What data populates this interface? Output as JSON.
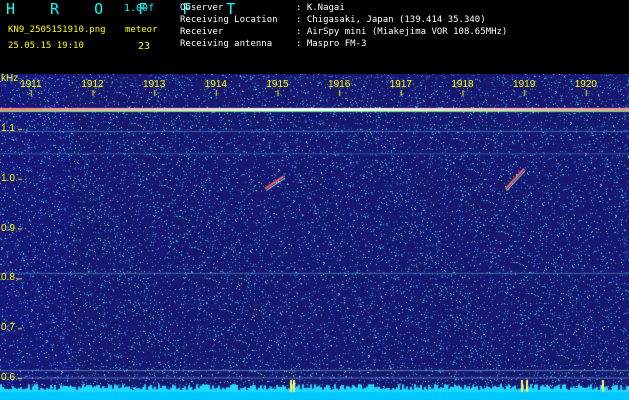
{
  "header": {
    "title": "H R O F F T",
    "version": "1.00f",
    "filename": "KN9_2505151910.png",
    "meteor_label": "meteor",
    "datetime": "25.05.15 19:10",
    "meteor_count": "23",
    "info_labels": [
      "Observer",
      "Receiving Location",
      "Receiver",
      "Receiving antenna"
    ],
    "info_values": [
      ": K.Nagai",
      ": Chigasaki, Japan (139.414 35.340)",
      ": AirSpy mini (Miakejima VOR 108.65MHz)",
      ": Maspro FM-3"
    ]
  },
  "chart_data": {
    "type": "heatmap",
    "ylabel": "kHz",
    "yticks": [
      "1.1",
      "1.0",
      "0.9",
      "0.8",
      "0.7",
      "0.6"
    ],
    "ytick_values": [
      1.1,
      1.0,
      0.9,
      0.8,
      0.7,
      0.6
    ],
    "xticks": [
      "1911",
      "1912",
      "1913",
      "1914",
      "1915",
      "1916",
      "1917",
      "1918",
      "1919",
      "1920"
    ],
    "ylim": [
      0.58,
      1.15
    ],
    "xlim": [
      1910.5,
      1920.7
    ],
    "carrier_khz": 1.14,
    "meteor_echoes": [
      {
        "t_start": 1914.8,
        "t_end": 1915.1,
        "f_start": 0.98,
        "f_end": 1.005
      },
      {
        "t_start": 1918.7,
        "t_end": 1919.0,
        "f_start": 0.98,
        "f_end": 1.02
      }
    ]
  },
  "colors": {
    "background": "#1a1a6e",
    "carrier": "#ffffff",
    "axis_text": "#ffff00",
    "header_text": "#00ffff",
    "gridline": "#7fb8d8"
  }
}
